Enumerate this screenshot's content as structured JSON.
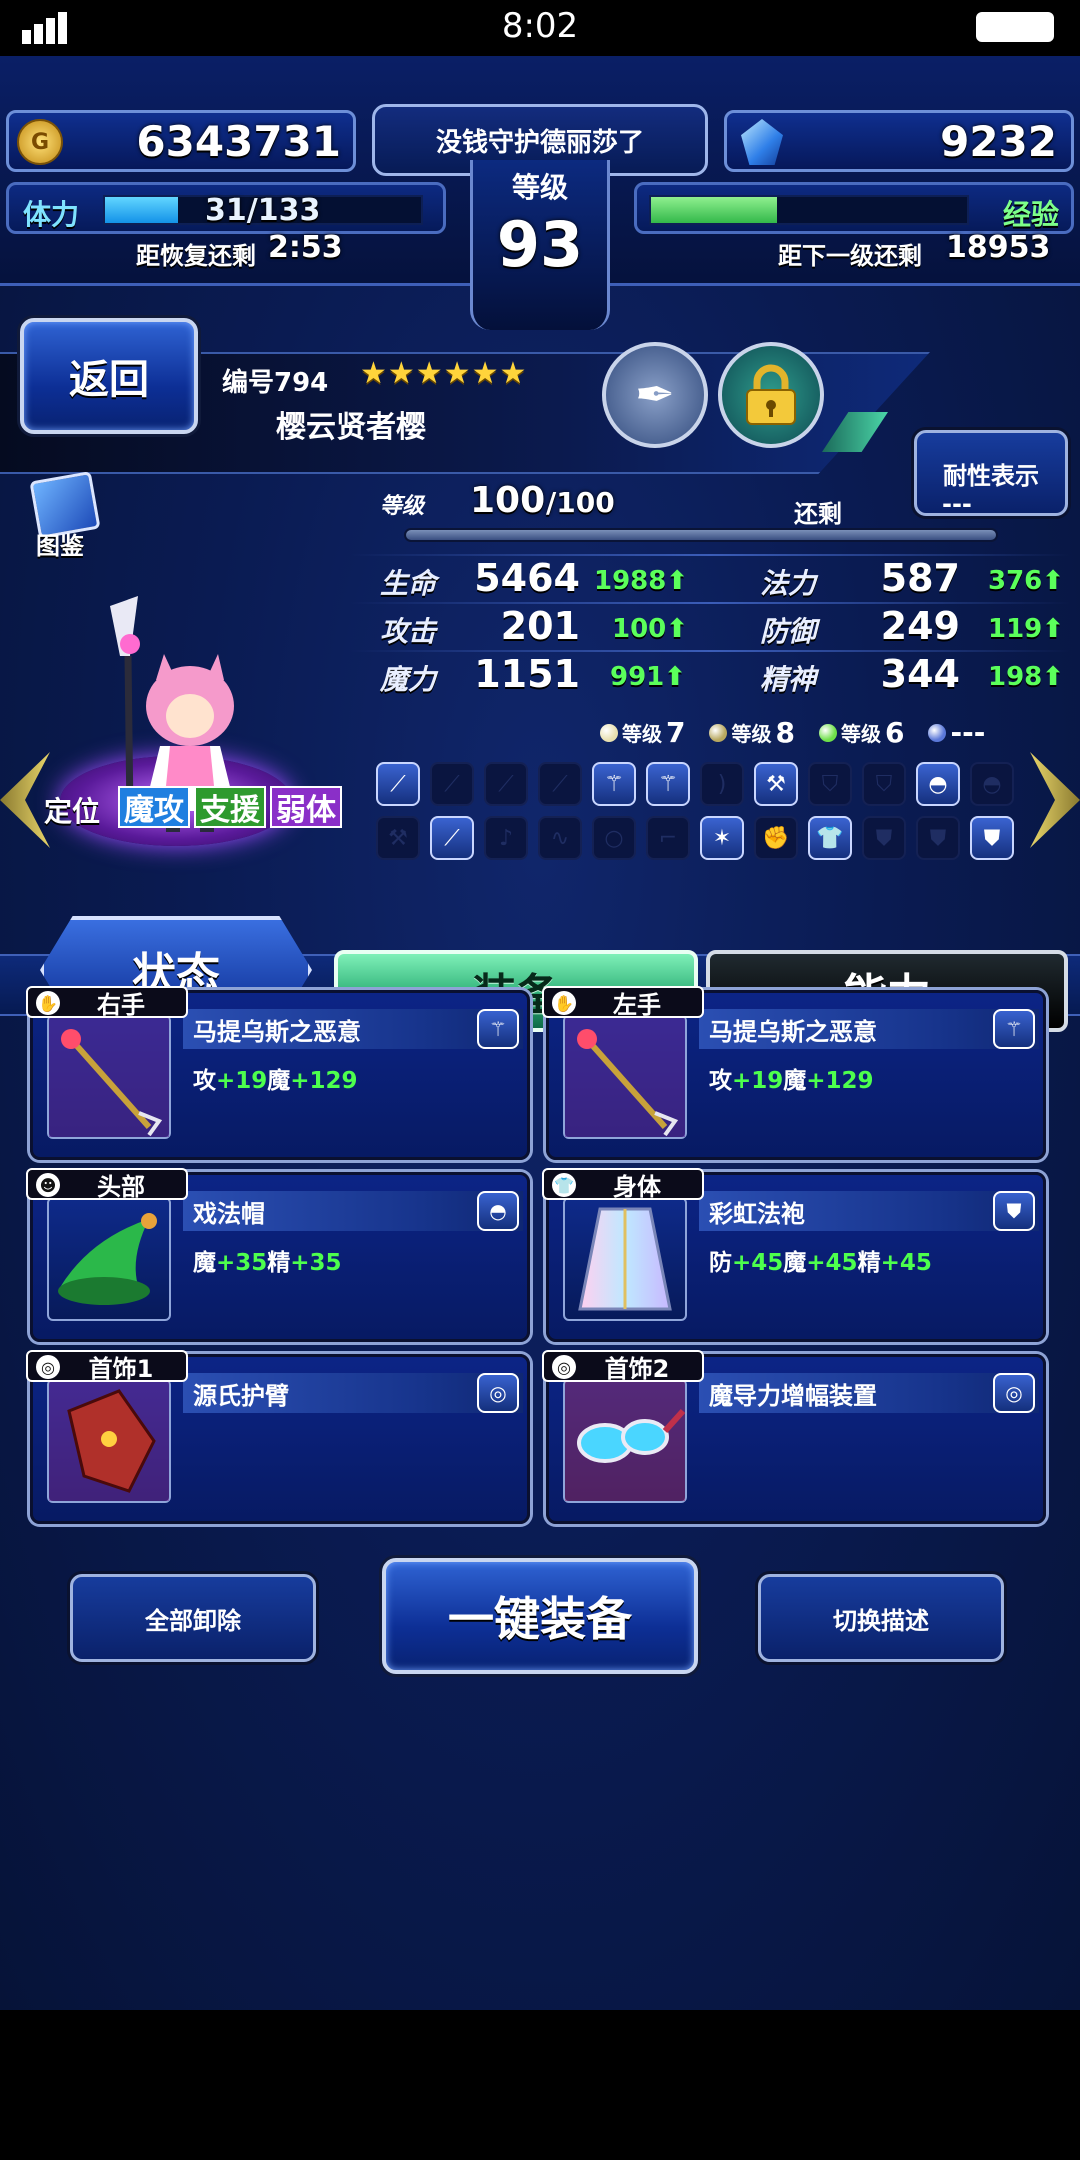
{
  "status_bar": {
    "time": "8:02"
  },
  "header": {
    "gil": "6343731",
    "player_name": "没钱守护德丽莎了",
    "level_label": "等级",
    "level": "93",
    "gems": "9232",
    "stamina_label": "体力",
    "stamina": "31/133",
    "stamina_fraction": 0.23,
    "recovery_label": "距恢复还剩",
    "recovery_time": "2:53",
    "exp_label": "经验",
    "exp_fraction": 0.4,
    "next_level_label": "距下一级还剩",
    "next_level_value": "18953"
  },
  "unit": {
    "back_label": "返回",
    "id_label": "编号794",
    "stars": "★★★★★★",
    "name": "樱云贤者樱",
    "resist_label": "耐性表示",
    "encyclopedia_label": "图鉴",
    "level_label": "等级",
    "level": "100",
    "level_max": "/100",
    "remaining_label": "还剩",
    "remaining_value": "---",
    "role_label": "定位",
    "roles": [
      "魔攻",
      "支援",
      "弱体"
    ]
  },
  "stats": [
    {
      "label": "生命",
      "value": "5464",
      "bonus": "1988"
    },
    {
      "label": "法力",
      "value": "587",
      "bonus": "376"
    },
    {
      "label": "攻击",
      "value": "201",
      "bonus": "100"
    },
    {
      "label": "防御",
      "value": "249",
      "bonus": "119"
    },
    {
      "label": "魔力",
      "value": "1151",
      "bonus": "991"
    },
    {
      "label": "精神",
      "value": "344",
      "bonus": "198"
    }
  ],
  "sphere_levels": [
    {
      "label": "等级",
      "value": "7",
      "color": "#e8e0b0"
    },
    {
      "label": "等级",
      "value": "8",
      "color": "#b8a860"
    },
    {
      "label": "等级",
      "value": "6",
      "color": "#6fe04a"
    },
    {
      "label": "",
      "value": "---",
      "color": "#5b78d8"
    }
  ],
  "tabs": {
    "status": "状态",
    "equipment": "装备",
    "ability": "能力"
  },
  "equipment": [
    {
      "slot": "右手",
      "slot_icon": "✋",
      "name": "马提乌斯之恶意",
      "type_icon": "staff-icon",
      "stats": [
        [
          "攻",
          "+19"
        ],
        [
          "魔",
          "+129"
        ]
      ]
    },
    {
      "slot": "左手",
      "slot_icon": "✋",
      "name": "马提乌斯之恶意",
      "type_icon": "staff-icon",
      "stats": [
        [
          "攻",
          "+19"
        ],
        [
          "魔",
          "+129"
        ]
      ]
    },
    {
      "slot": "头部",
      "slot_icon": "☻",
      "name": "戏法帽",
      "type_icon": "hat-icon",
      "stats": [
        [
          "魔",
          "+35"
        ],
        [
          "精",
          "+35"
        ]
      ]
    },
    {
      "slot": "身体",
      "slot_icon": "👕",
      "name": "彩虹法袍",
      "type_icon": "robe-icon",
      "stats": [
        [
          "防",
          "+45"
        ],
        [
          "魔",
          "+45"
        ],
        [
          "精",
          "+45"
        ]
      ]
    },
    {
      "slot": "首饰1",
      "slot_icon": "◎",
      "name": "源氏护臂",
      "type_icon": "ring-icon",
      "stats": []
    },
    {
      "slot": "首饰2",
      "slot_icon": "◎",
      "name": "魔导力增幅装置",
      "type_icon": "ring-icon",
      "stats": []
    }
  ],
  "actions": {
    "unequip_all": "全部卸除",
    "auto_equip": "一键装备",
    "toggle_desc": "切换描述"
  },
  "colors": {
    "bonus_green": "#4dff4d",
    "panel_blue": "#0c2486",
    "active_tab_green": "#3fbf7f"
  }
}
